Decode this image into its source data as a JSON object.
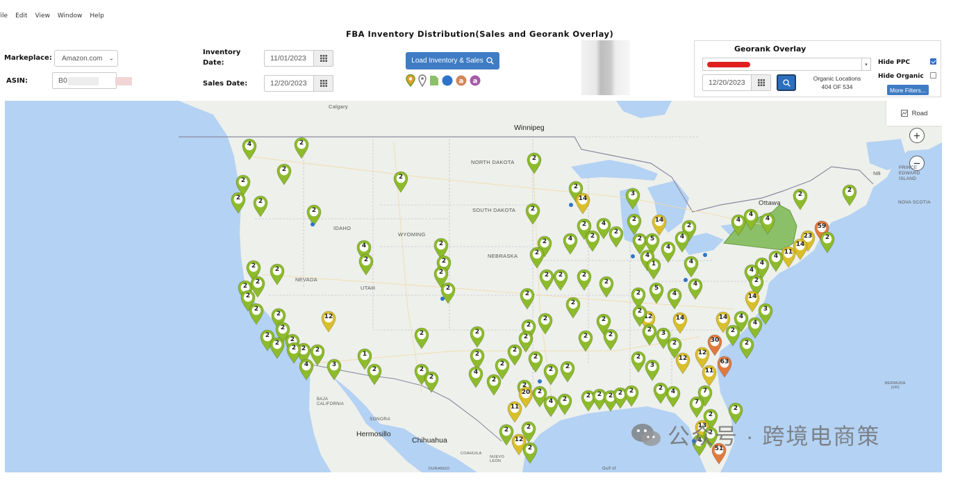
{
  "menu": [
    "File",
    "Edit",
    "View",
    "Window",
    "Help"
  ],
  "app_title": "FBA Inventory Distribution(Sales and Georank Overlay)",
  "filters": {
    "marketplace_label": "Markeplace:",
    "marketplace_value": "Amazon.com",
    "asin_label": "ASIN:",
    "asin_value": "B0",
    "inventory_date_label_1": "Inventory",
    "inventory_date_label_2": "Date:",
    "inventory_date_value": "11/01/2023",
    "sales_date_label": "Sales Date:",
    "sales_date_value": "12/20/2023",
    "load_button": "Load Inventory & Sales"
  },
  "georank": {
    "title": "Georank Overlay",
    "date_value": "12/20/2023",
    "organic_locations_label": "Organic Locations",
    "organic_locations_count": "404 OF 534",
    "hide_ppc_label": "Hide PPC",
    "hide_ppc_checked": true,
    "hide_organic_label": "Hide Organic",
    "hide_organic_checked": false,
    "more_filters": "More Filters..."
  },
  "map": {
    "road_button": "Road",
    "labels": {
      "calgary": "Calgary",
      "winnipeg": "Winnipeg",
      "north_dakota": "NORTH DAKOTA",
      "south_dakota": "SOUTH DAKOTA",
      "idaho": "IDAHO",
      "wyoming": "WYOMING",
      "nebraska": "NEBRASKA",
      "nevada": "NEVADA",
      "utah": "UTAH",
      "ottawa": "Ottawa",
      "nb": "NB",
      "pei_1": "PRINCE",
      "pei_2": "EDWARD",
      "pei_3": "ISLAND",
      "nova_scotia": "NOVA SCOTIA",
      "bermuda_1": "BERMUDA",
      "bermuda_2": "(UK)",
      "baja_1": "BAJA",
      "baja_2": "CALIFORNIA",
      "sonora": "SONORA",
      "hermosillo": "Hermosillo",
      "chihuahua": "Chihuahua",
      "coahuila": "COAHUILA",
      "nuevo_1": "NUEVO",
      "nuevo_2": "LEÓN",
      "durango": "DURANGO",
      "gulf": "Gulf of"
    },
    "colors": {
      "green_pin": "#8dbb2c",
      "yellow_pin": "#d9bf2a",
      "orange_pin": "#e07a3e",
      "state_highlight": "#8cc068",
      "ocean": "#b4d2f3",
      "land": "#eef0eb"
    }
  },
  "watermark": "公众号 · 跨境电商策"
}
